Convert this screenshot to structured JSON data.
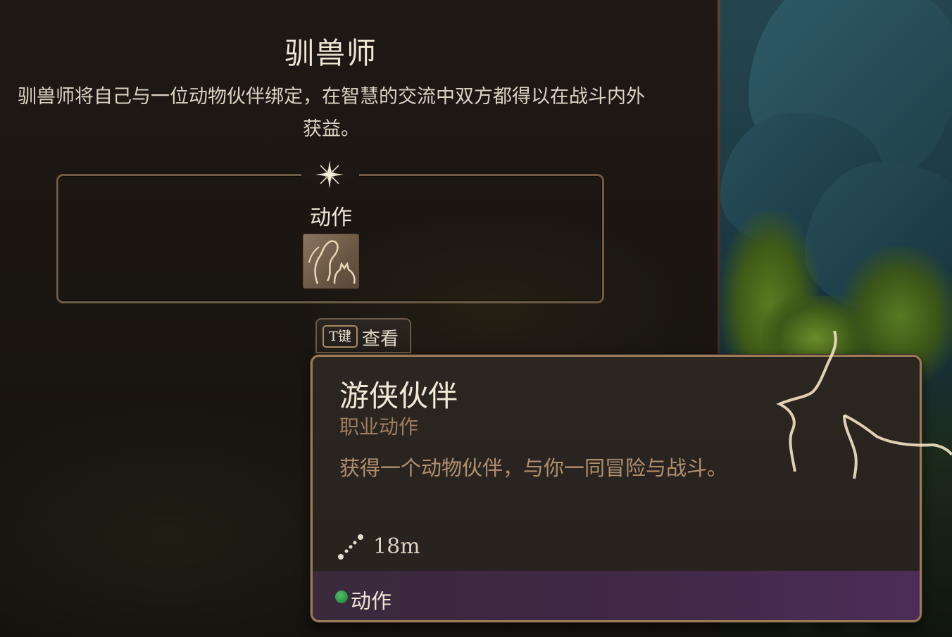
{
  "class": {
    "title": "驯兽师",
    "description": "驯兽师将自己与一位动物伙伴绑定，在智慧的交流中双方都得以在战斗内外获益。"
  },
  "section": {
    "label": "动作",
    "icon": "beast-companion-icon"
  },
  "key_hint": {
    "key": "T键",
    "action": "查看"
  },
  "tooltip": {
    "name": "游侠伙伴",
    "subtitle": "职业动作",
    "description": "获得一个动物伙伴，与你一同冒险与战斗。",
    "range": "18m",
    "footer_label": "动作",
    "footer_dot_color": "#2e9a48"
  },
  "colors": {
    "panel_border": "#6e5a45",
    "tooltip_border": "#9a7a57",
    "subtitle": "#9c7e60",
    "description_text": "#b08f70"
  }
}
